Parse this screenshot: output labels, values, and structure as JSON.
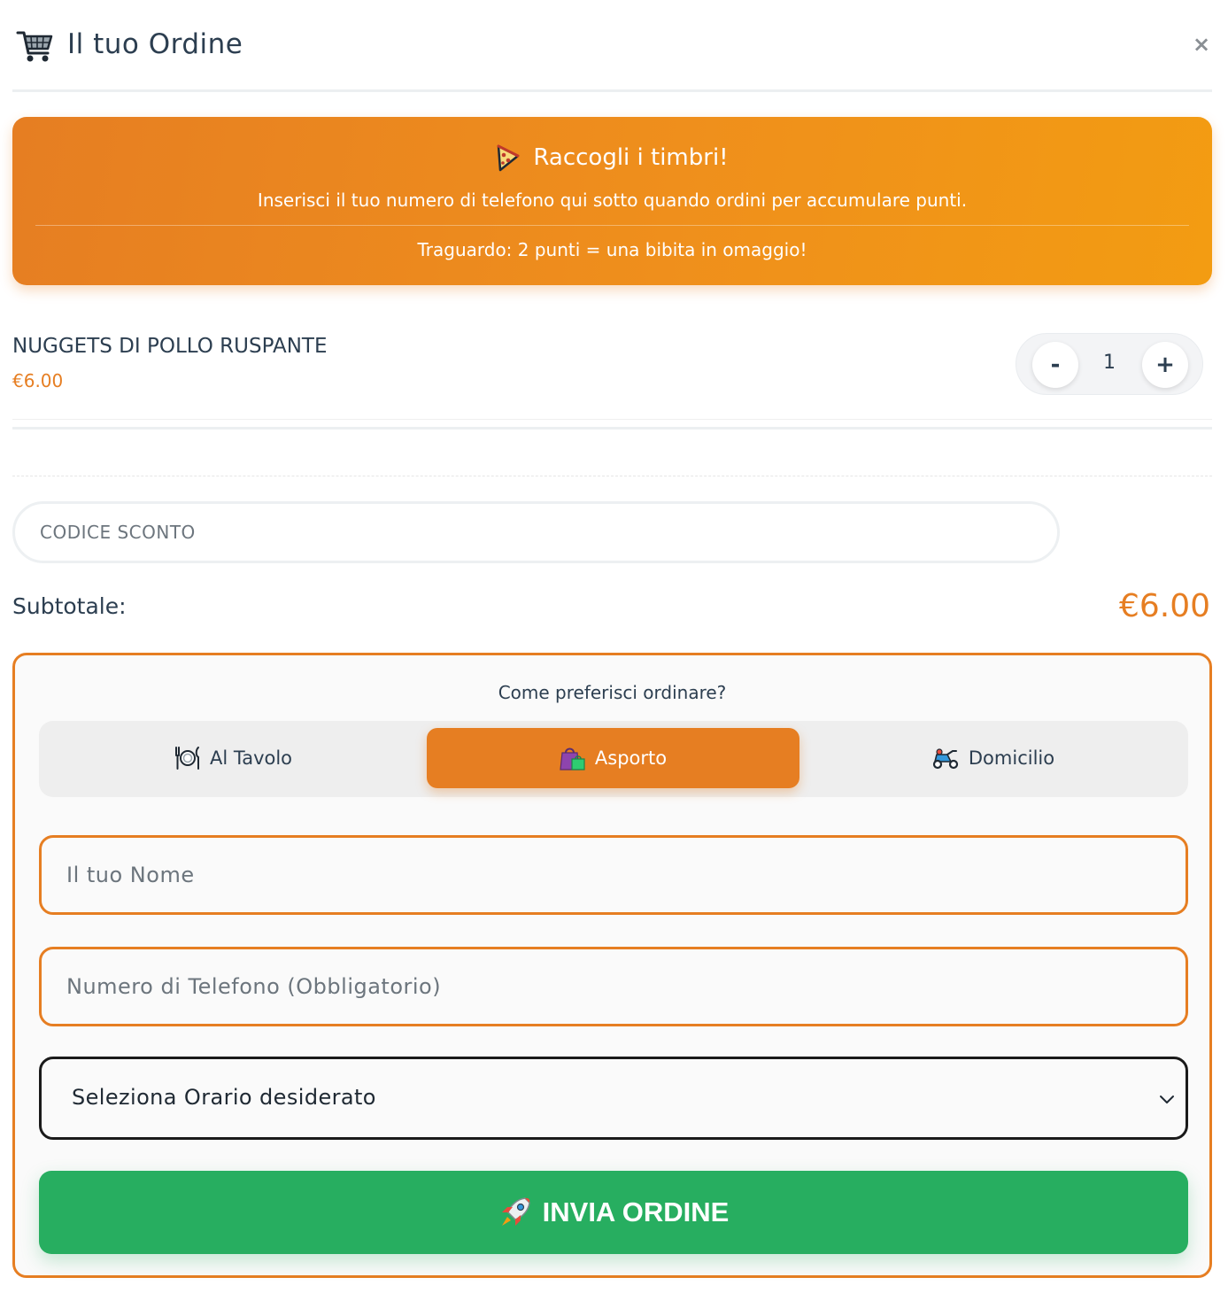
{
  "header": {
    "title": "Il tuo Ordine",
    "cart_icon": "shopping-cart-icon",
    "close_label": "×"
  },
  "promo": {
    "icon": "pizza-slice-icon",
    "title": "Raccogli i timbri!",
    "subtitle": "Inserisci il tuo numero di telefono qui sotto quando ordini per accumulare punti.",
    "goal": "Traguardo: 2 punti = una bibita in omaggio!"
  },
  "cart": {
    "items": [
      {
        "name": "NUGGETS DI POLLO RUSPANTE",
        "price": "€6.00",
        "quantity": "1"
      }
    ],
    "minus_label": "-",
    "plus_label": "+"
  },
  "discount": {
    "placeholder": "CODICE SCONTO",
    "value": ""
  },
  "subtotal": {
    "label": "Subtotale:",
    "value": "€6.00"
  },
  "order": {
    "question": "Come preferisci ordinare?",
    "tabs": [
      {
        "label": "Al Tavolo",
        "icon": "plate-cutlery-icon",
        "active": false
      },
      {
        "label": "Asporto",
        "icon": "shopping-bag-icon",
        "active": true
      },
      {
        "label": "Domicilio",
        "icon": "delivery-scooter-icon",
        "active": false
      }
    ],
    "name_placeholder": "Il tuo Nome",
    "phone_placeholder": "Numero di Telefono (Obbligatorio)",
    "time_select": "Seleziona Orario desiderato",
    "submit_label": "INVIA ORDINE",
    "submit_icon": "rocket-icon"
  },
  "colors": {
    "accent": "#e67e22",
    "success": "#27ae60",
    "text": "#2c3e50"
  }
}
